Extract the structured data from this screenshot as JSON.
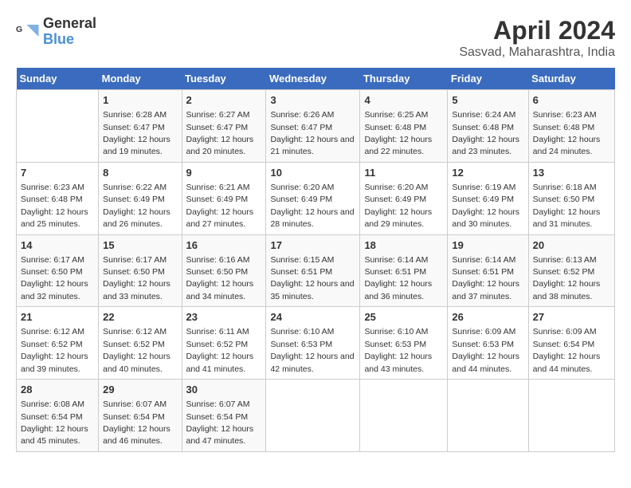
{
  "logo": {
    "general": "General",
    "blue": "Blue"
  },
  "title": "April 2024",
  "subtitle": "Sasvad, Maharashtra, India",
  "weekdays": [
    "Sunday",
    "Monday",
    "Tuesday",
    "Wednesday",
    "Thursday",
    "Friday",
    "Saturday"
  ],
  "weeks": [
    [
      {
        "num": "",
        "sunrise": "",
        "sunset": "",
        "daylight": ""
      },
      {
        "num": "1",
        "sunrise": "Sunrise: 6:28 AM",
        "sunset": "Sunset: 6:47 PM",
        "daylight": "Daylight: 12 hours and 19 minutes."
      },
      {
        "num": "2",
        "sunrise": "Sunrise: 6:27 AM",
        "sunset": "Sunset: 6:47 PM",
        "daylight": "Daylight: 12 hours and 20 minutes."
      },
      {
        "num": "3",
        "sunrise": "Sunrise: 6:26 AM",
        "sunset": "Sunset: 6:47 PM",
        "daylight": "Daylight: 12 hours and 21 minutes."
      },
      {
        "num": "4",
        "sunrise": "Sunrise: 6:25 AM",
        "sunset": "Sunset: 6:48 PM",
        "daylight": "Daylight: 12 hours and 22 minutes."
      },
      {
        "num": "5",
        "sunrise": "Sunrise: 6:24 AM",
        "sunset": "Sunset: 6:48 PM",
        "daylight": "Daylight: 12 hours and 23 minutes."
      },
      {
        "num": "6",
        "sunrise": "Sunrise: 6:23 AM",
        "sunset": "Sunset: 6:48 PM",
        "daylight": "Daylight: 12 hours and 24 minutes."
      }
    ],
    [
      {
        "num": "7",
        "sunrise": "Sunrise: 6:23 AM",
        "sunset": "Sunset: 6:48 PM",
        "daylight": "Daylight: 12 hours and 25 minutes."
      },
      {
        "num": "8",
        "sunrise": "Sunrise: 6:22 AM",
        "sunset": "Sunset: 6:49 PM",
        "daylight": "Daylight: 12 hours and 26 minutes."
      },
      {
        "num": "9",
        "sunrise": "Sunrise: 6:21 AM",
        "sunset": "Sunset: 6:49 PM",
        "daylight": "Daylight: 12 hours and 27 minutes."
      },
      {
        "num": "10",
        "sunrise": "Sunrise: 6:20 AM",
        "sunset": "Sunset: 6:49 PM",
        "daylight": "Daylight: 12 hours and 28 minutes."
      },
      {
        "num": "11",
        "sunrise": "Sunrise: 6:20 AM",
        "sunset": "Sunset: 6:49 PM",
        "daylight": "Daylight: 12 hours and 29 minutes."
      },
      {
        "num": "12",
        "sunrise": "Sunrise: 6:19 AM",
        "sunset": "Sunset: 6:49 PM",
        "daylight": "Daylight: 12 hours and 30 minutes."
      },
      {
        "num": "13",
        "sunrise": "Sunrise: 6:18 AM",
        "sunset": "Sunset: 6:50 PM",
        "daylight": "Daylight: 12 hours and 31 minutes."
      }
    ],
    [
      {
        "num": "14",
        "sunrise": "Sunrise: 6:17 AM",
        "sunset": "Sunset: 6:50 PM",
        "daylight": "Daylight: 12 hours and 32 minutes."
      },
      {
        "num": "15",
        "sunrise": "Sunrise: 6:17 AM",
        "sunset": "Sunset: 6:50 PM",
        "daylight": "Daylight: 12 hours and 33 minutes."
      },
      {
        "num": "16",
        "sunrise": "Sunrise: 6:16 AM",
        "sunset": "Sunset: 6:50 PM",
        "daylight": "Daylight: 12 hours and 34 minutes."
      },
      {
        "num": "17",
        "sunrise": "Sunrise: 6:15 AM",
        "sunset": "Sunset: 6:51 PM",
        "daylight": "Daylight: 12 hours and 35 minutes."
      },
      {
        "num": "18",
        "sunrise": "Sunrise: 6:14 AM",
        "sunset": "Sunset: 6:51 PM",
        "daylight": "Daylight: 12 hours and 36 minutes."
      },
      {
        "num": "19",
        "sunrise": "Sunrise: 6:14 AM",
        "sunset": "Sunset: 6:51 PM",
        "daylight": "Daylight: 12 hours and 37 minutes."
      },
      {
        "num": "20",
        "sunrise": "Sunrise: 6:13 AM",
        "sunset": "Sunset: 6:52 PM",
        "daylight": "Daylight: 12 hours and 38 minutes."
      }
    ],
    [
      {
        "num": "21",
        "sunrise": "Sunrise: 6:12 AM",
        "sunset": "Sunset: 6:52 PM",
        "daylight": "Daylight: 12 hours and 39 minutes."
      },
      {
        "num": "22",
        "sunrise": "Sunrise: 6:12 AM",
        "sunset": "Sunset: 6:52 PM",
        "daylight": "Daylight: 12 hours and 40 minutes."
      },
      {
        "num": "23",
        "sunrise": "Sunrise: 6:11 AM",
        "sunset": "Sunset: 6:52 PM",
        "daylight": "Daylight: 12 hours and 41 minutes."
      },
      {
        "num": "24",
        "sunrise": "Sunrise: 6:10 AM",
        "sunset": "Sunset: 6:53 PM",
        "daylight": "Daylight: 12 hours and 42 minutes."
      },
      {
        "num": "25",
        "sunrise": "Sunrise: 6:10 AM",
        "sunset": "Sunset: 6:53 PM",
        "daylight": "Daylight: 12 hours and 43 minutes."
      },
      {
        "num": "26",
        "sunrise": "Sunrise: 6:09 AM",
        "sunset": "Sunset: 6:53 PM",
        "daylight": "Daylight: 12 hours and 44 minutes."
      },
      {
        "num": "27",
        "sunrise": "Sunrise: 6:09 AM",
        "sunset": "Sunset: 6:54 PM",
        "daylight": "Daylight: 12 hours and 44 minutes."
      }
    ],
    [
      {
        "num": "28",
        "sunrise": "Sunrise: 6:08 AM",
        "sunset": "Sunset: 6:54 PM",
        "daylight": "Daylight: 12 hours and 45 minutes."
      },
      {
        "num": "29",
        "sunrise": "Sunrise: 6:07 AM",
        "sunset": "Sunset: 6:54 PM",
        "daylight": "Daylight: 12 hours and 46 minutes."
      },
      {
        "num": "30",
        "sunrise": "Sunrise: 6:07 AM",
        "sunset": "Sunset: 6:54 PM",
        "daylight": "Daylight: 12 hours and 47 minutes."
      },
      {
        "num": "",
        "sunrise": "",
        "sunset": "",
        "daylight": ""
      },
      {
        "num": "",
        "sunrise": "",
        "sunset": "",
        "daylight": ""
      },
      {
        "num": "",
        "sunrise": "",
        "sunset": "",
        "daylight": ""
      },
      {
        "num": "",
        "sunrise": "",
        "sunset": "",
        "daylight": ""
      }
    ]
  ]
}
